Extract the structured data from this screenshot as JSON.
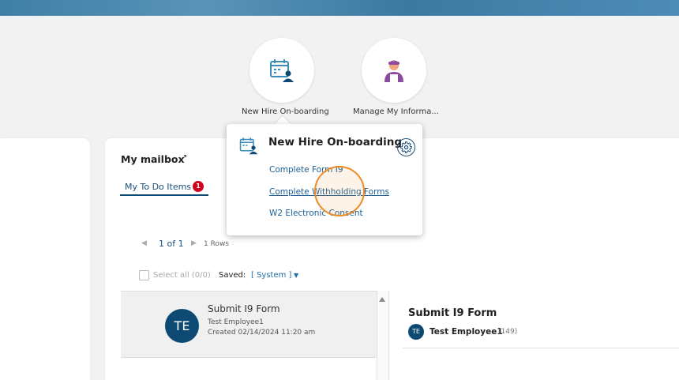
{
  "colors": {
    "brand_dark": "#0d4a73",
    "link": "#1d5f96",
    "badge_red": "#d0021b",
    "highlight_orange": "#f08a24"
  },
  "tiles": [
    {
      "label": "New Hire On-boarding",
      "icon": "calendar-person-icon"
    },
    {
      "label": "Manage My Informa...",
      "icon": "person-icon"
    }
  ],
  "popover": {
    "title": "New Hire On-boarding",
    "icon": "calendar-person-icon",
    "settings_icon": "gear-icon",
    "links": [
      "Complete Form I9",
      "Complete Withholding Forms",
      "W2 Electronic Consent"
    ]
  },
  "mailbox": {
    "title": "My mailbox",
    "ext_icon": "↗",
    "tab_label": "My To Do Items",
    "tab_badge": "1",
    "pager": {
      "text": "1 of 1",
      "prev": "◀",
      "next": "▶",
      "rows": "1 Rows"
    },
    "select_all": "Select all (0/0)",
    "saved_label": "Saved:",
    "saved_value": "[ System ]",
    "items": [
      {
        "initials": "TE",
        "title": "Submit I9 Form",
        "sub1": "Test Employee1",
        "sub2": "Created 02/14/2024 11:20 am"
      }
    ]
  },
  "detail": {
    "title": "Submit I9 Form",
    "initials": "TE",
    "name": "Test Employee1",
    "count": "(149)"
  }
}
